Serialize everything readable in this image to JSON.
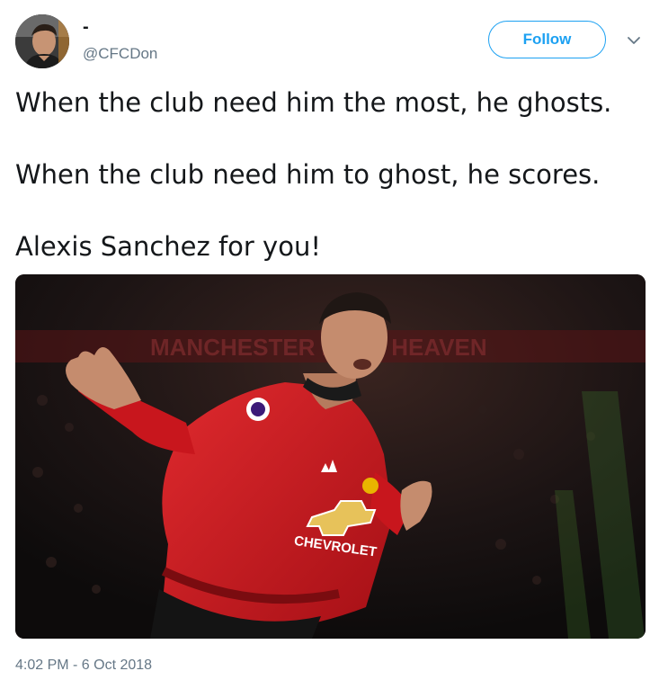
{
  "tweet": {
    "display_name": "-",
    "handle": "@CFCDon",
    "avatar_icon": "profile-photo",
    "follow_label": "Follow",
    "menu_icon": "chevron-down-icon",
    "text_lines": [
      "When the club need him the most, he ghosts.",
      "When the club need him to ghost, he scores.",
      "Alexis Sanchez for you!"
    ],
    "media": {
      "type": "photo",
      "subject": "footballer celebrating in red kit",
      "banner_text": "MANCHESTER IS MY HEAVEN",
      "shirt_sponsor": "CHEVROLET"
    },
    "timestamp": "4:02 PM - 6 Oct 2018"
  },
  "colors": {
    "accent": "#1da1f2",
    "text": "#14171a",
    "secondary_text": "#657786",
    "kit_red": "#c8161d"
  }
}
